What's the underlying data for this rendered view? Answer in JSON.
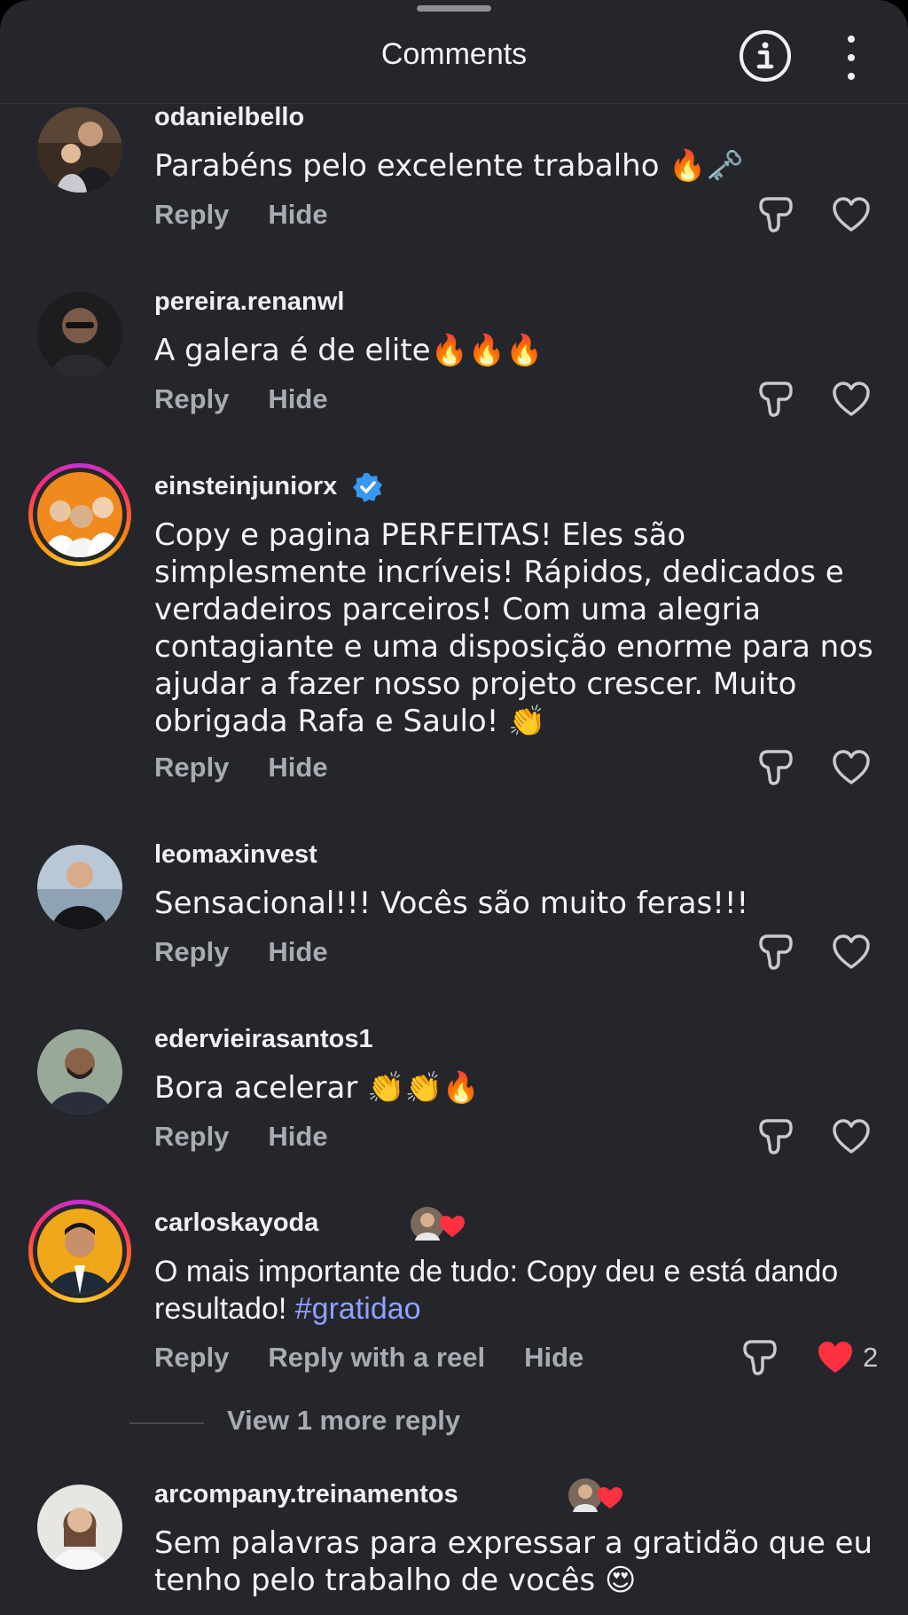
{
  "header": {
    "title": "Comments"
  },
  "comments": [
    {
      "username": "odanielbello",
      "text": "Parabéns pelo excelente trabalho 🔥🗝️",
      "reply": "Reply",
      "hide": "Hide"
    },
    {
      "username": "pereira.renanwl",
      "text": "A galera é de elite🔥🔥🔥",
      "reply": "Reply",
      "hide": "Hide"
    },
    {
      "username": "einsteinjuniorx",
      "verified": true,
      "text": "Copy e pagina PERFEITAS! Eles são simplesmente incríveis! Rápidos, dedicados e verdadeiros parceiros! Com uma alegria contagiante e uma disposição enorme para nos ajudar a fazer nosso projeto crescer. Muito obrigada Rafa e Saulo! 👏",
      "reply": "Reply",
      "hide": "Hide"
    },
    {
      "username": "leomaxinvest",
      "text": "Sensacional!!! Vocês são muito feras!!!",
      "reply": "Reply",
      "hide": "Hide"
    },
    {
      "username": "edervieirasantos1",
      "text": "Bora acelerar 👏👏🔥",
      "reply": "Reply",
      "hide": "Hide"
    },
    {
      "username": "carloskayoda",
      "text_plain": "O mais importante de tudo: Copy deu e está dando resultado! ",
      "hashtag": "#gratidao",
      "reply": "Reply",
      "reply_reel": "Reply with a reel",
      "hide": "Hide",
      "likes": "2",
      "liked": true
    },
    {
      "username": "arcompany.treinamentos",
      "text": "Sem palavras para expressar a gratidão que eu tenho pelo trabalho de vocês 😍"
    }
  ],
  "view_more": "View 1 more reply",
  "colors": {
    "background": "#25262b",
    "muted": "#a9abb3",
    "hashtag": "#8ea2ff",
    "like": "#ff3040",
    "verified": "#3897f0"
  }
}
